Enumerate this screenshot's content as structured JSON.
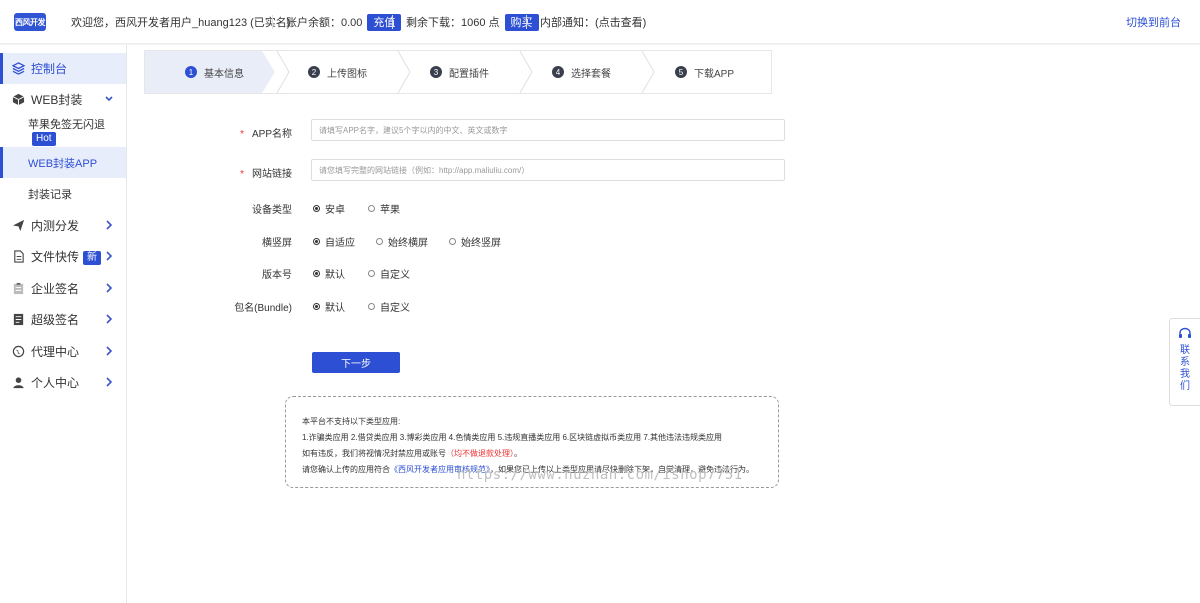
{
  "header": {
    "logo": "西风开发",
    "welcome": "欢迎您，西风开发者用户_huang123  (已实名)",
    "balance_label": "账户余额：0.00",
    "recharge_btn": "充值",
    "downloads_label": "剩余下载：1060 点",
    "buy_btn": "购买",
    "notice": "内部通知：(点击查看)",
    "switch_link": "切换到前台"
  },
  "sidebar": {
    "items": [
      {
        "label": "控制台",
        "icon": "layers-icon"
      },
      {
        "label": "WEB封装",
        "icon": "box-icon"
      },
      {
        "label": "苹果免签无闪退",
        "badge": "Hot"
      },
      {
        "label": "WEB封装APP"
      },
      {
        "label": "封装记录"
      },
      {
        "label": "内测分发",
        "icon": "send-icon"
      },
      {
        "label": "文件快传",
        "icon": "file-icon",
        "badge": "新"
      },
      {
        "label": "企业签名",
        "icon": "clipboard-icon"
      },
      {
        "label": "超级签名",
        "icon": "document-icon"
      },
      {
        "label": "代理中心",
        "icon": "globe-icon"
      },
      {
        "label": "个人中心",
        "icon": "user-icon"
      }
    ]
  },
  "steps": [
    {
      "num": "1",
      "label": "基本信息"
    },
    {
      "num": "2",
      "label": "上传图标"
    },
    {
      "num": "3",
      "label": "配置插件"
    },
    {
      "num": "4",
      "label": "选择套餐"
    },
    {
      "num": "5",
      "label": "下载APP"
    }
  ],
  "form": {
    "app_name": {
      "label": "APP名称",
      "placeholder": "请填写APP名字，建议5个字以内的中文、英文或数字"
    },
    "site_url": {
      "label": "网站链接",
      "placeholder": "请您填写完整的网站链接（例如：http://app.maliuliu.com/）"
    },
    "device": {
      "label": "设备类型",
      "options": [
        "安卓",
        "苹果"
      ]
    },
    "orientation": {
      "label": "横竖屏",
      "options": [
        "自适应",
        "始终横屏",
        "始终竖屏"
      ]
    },
    "version": {
      "label": "版本号",
      "options": [
        "默认",
        "自定义"
      ]
    },
    "bundle": {
      "label": "包名(Bundle)",
      "options": [
        "默认",
        "自定义"
      ]
    },
    "next_btn": "下一步"
  },
  "notice": {
    "line1": "本平台不支持以下类型应用:",
    "line2": "1.诈骗类应用 2.借贷类应用 3.博彩类应用 4.色情类应用 5.违规直播类应用 6.区块链虚拟币类应用 7.其他违法违规类应用",
    "line3a": "如有违反，我们将视情况封禁应用或账号",
    "line3b": "（均不做退款处理）",
    "line3c": "。",
    "line4a": "请您确认上传的应用符合",
    "line4b": "《西风开发者应用审核规范》",
    "line4c": "，如果您已上传以上类型应用请尽快删除下架，自觉清理，避免违法行为。"
  },
  "watermark": "https://www.huzhan.com/ishop7751",
  "contact": {
    "label": "联系我们",
    "icon": "headset-icon"
  },
  "colors": {
    "accent": "#2d4fd4",
    "danger": "#e33333"
  }
}
